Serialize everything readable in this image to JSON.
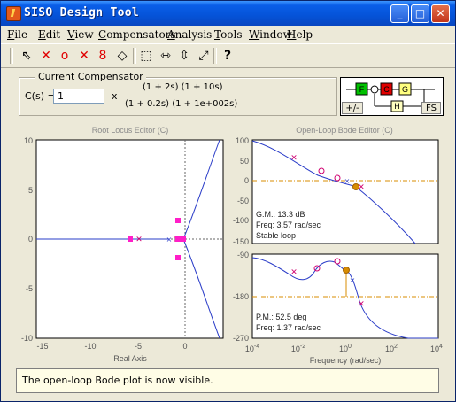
{
  "window": {
    "title": "SISO Design Tool"
  },
  "title_buttons": {
    "minimize": "_",
    "maximize": "□",
    "close": "✕"
  },
  "menu": [
    {
      "label": "File",
      "underline": "F"
    },
    {
      "label": "Edit",
      "underline": "E"
    },
    {
      "label": "View",
      "underline": "V"
    },
    {
      "label": "Compensators",
      "underline": "C"
    },
    {
      "label": "Analysis",
      "underline": "A"
    },
    {
      "label": "Tools",
      "underline": "T"
    },
    {
      "label": "Window",
      "underline": "W"
    },
    {
      "label": "Help",
      "underline": "H"
    }
  ],
  "toolbar": [
    {
      "name": "select-arrow-icon",
      "glyph": "⇖",
      "color": "#000000"
    },
    {
      "name": "add-real-pole-icon",
      "glyph": "✕",
      "color": "#e00000"
    },
    {
      "name": "add-real-zero-icon",
      "glyph": "o",
      "color": "#e00000"
    },
    {
      "name": "add-complex-pole-icon",
      "glyph": "✕",
      "color": "#e00000"
    },
    {
      "name": "add-complex-zero-icon",
      "glyph": "8",
      "color": "#e00000"
    },
    {
      "name": "erase-icon",
      "glyph": "◇",
      "color": "#000000"
    },
    {
      "name": "zoom-box-icon",
      "glyph": "⬚",
      "color": "#000000"
    },
    {
      "name": "zoom-x-icon",
      "glyph": "⇿",
      "color": "#000000"
    },
    {
      "name": "zoom-y-icon",
      "glyph": "⇳",
      "color": "#000000"
    },
    {
      "name": "fit-axes-icon",
      "glyph": "⤢",
      "color": "#000000"
    },
    {
      "name": "help-pointer-icon",
      "glyph": "?",
      "color": "#000000"
    }
  ],
  "compensator": {
    "legend": "Current Compensator",
    "label": "C(s) =",
    "gain": "1",
    "times": "x",
    "numerator": "(1 + 2s) (1 + 10s)",
    "denominator": "(1 + 0.2s) (1 + 1e+002s)"
  },
  "diagram": {
    "blocks": [
      "F",
      "C",
      "G",
      "H"
    ],
    "block_colors": {
      "F": "#00c000",
      "C": "#e00000",
      "G": "#ffff80",
      "H": "#ffffc0"
    },
    "sign_button": "+/-",
    "fs_button": "FS"
  },
  "root_locus": {
    "title": "Root Locus Editor (C)",
    "xlabel": "Real Axis",
    "xticks": [
      "-15",
      "-10",
      "-5",
      "0"
    ],
    "yticks": [
      "10",
      "5",
      "0",
      "-5",
      "-10"
    ]
  },
  "bode": {
    "title": "Open-Loop Bode Editor (C)",
    "mag_yticks": [
      "100",
      "50",
      "0",
      "-50",
      "-100",
      "-150"
    ],
    "phase_yticks": [
      "-90",
      "-180",
      "-270"
    ],
    "xlabel": "Frequency (rad/sec)",
    "xtick_exponents": [
      "-4",
      "-2",
      "0",
      "2",
      "4"
    ],
    "gm_text": "G.M.: 13.3 dB",
    "gm_freq": "Freq: 3.57 rad/sec",
    "stability": "Stable loop",
    "pm_text": "P.M.: 52.5 deg",
    "pm_freq": "Freq: 1.37 rad/sec"
  },
  "status": {
    "message": "The open-loop Bode plot is now visible."
  },
  "colors": {
    "curve": "#2a3cc8",
    "pole_zero": "#d00070",
    "cl_pole": "#ff1ec8",
    "margin": "#d88c00"
  }
}
